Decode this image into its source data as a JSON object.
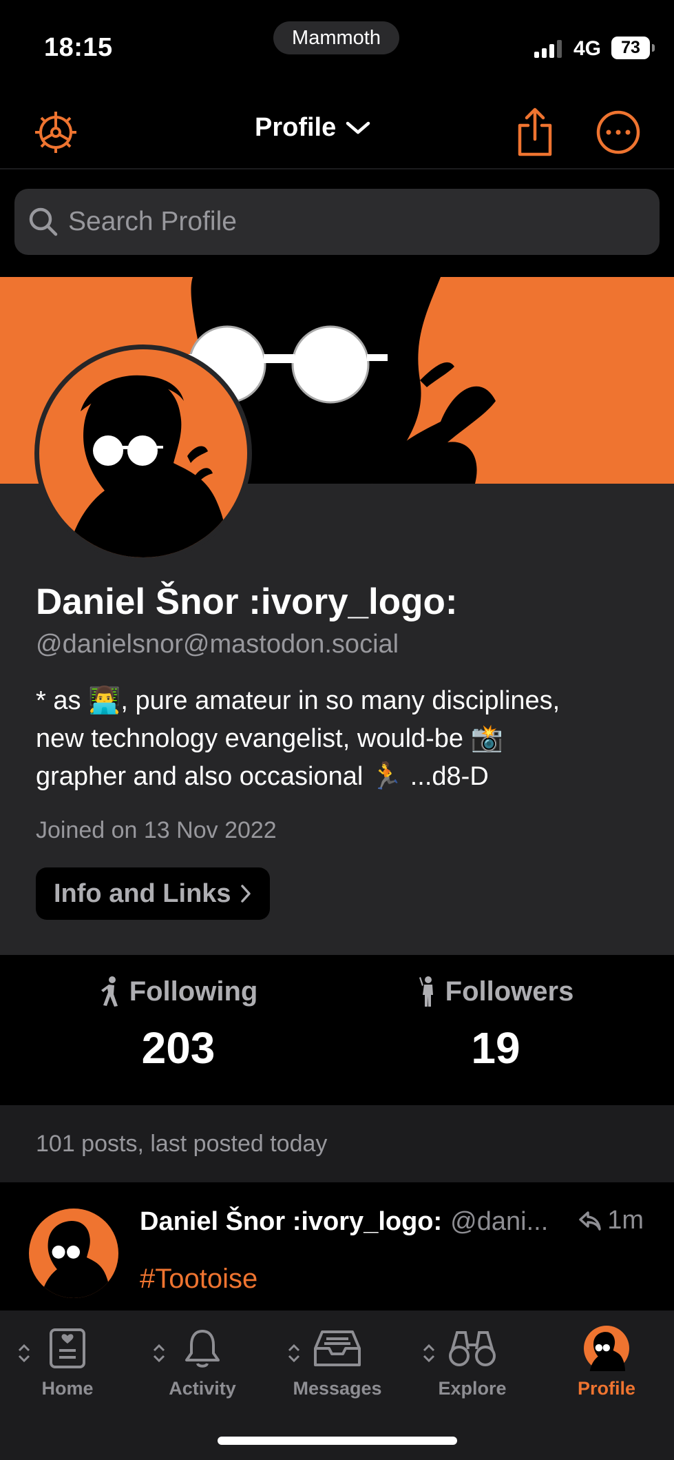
{
  "status": {
    "time": "18:15",
    "app_pill": "Mammoth",
    "network": "4G",
    "battery": "73"
  },
  "nav": {
    "title": "Profile"
  },
  "search": {
    "placeholder": "Search Profile"
  },
  "profile": {
    "display_name": "Daniel Šnor :ivory_logo:",
    "handle": "@danielsnor@mastodon.social",
    "bio_line1": "* as 👨‍💻, pure amateur in so many disciplines,",
    "bio_line2": "new technology evangelist, would-be 📸",
    "bio_line3": "grapher and also occasional 🏃 ...d8-D",
    "joined": "Joined on 13 Nov 2022",
    "info_button": "Info and Links"
  },
  "stats": {
    "following_label": "Following",
    "following_value": "203",
    "followers_label": "Followers",
    "followers_value": "19"
  },
  "posts_summary": "101 posts, last posted today",
  "post": {
    "name": "Daniel Šnor :ivory_logo:",
    "handle": "@dani...",
    "time": "1m",
    "tag": "#Tootoise"
  },
  "tabs": [
    {
      "label": "Home",
      "icon": "home-icon"
    },
    {
      "label": "Activity",
      "icon": "bell-icon"
    },
    {
      "label": "Messages",
      "icon": "inbox-icon"
    },
    {
      "label": "Explore",
      "icon": "binoculars-icon"
    },
    {
      "label": "Profile",
      "icon": "profile-avatar-icon"
    }
  ],
  "colors": {
    "accent": "#ef7430",
    "background": "#000000",
    "card": "#262628",
    "secondary_text": "#98989d"
  }
}
